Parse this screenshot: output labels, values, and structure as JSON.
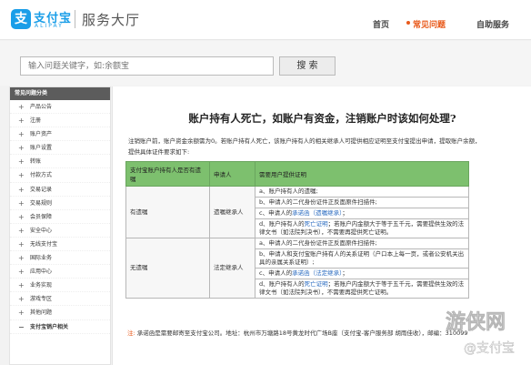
{
  "header": {
    "logo_mark": "支",
    "logo_cn": "支付宝",
    "logo_en": "ALIPAY",
    "hall": "服务大厅",
    "nav": {
      "home": "首页",
      "faq": "常见问题",
      "self_service": "自助服务"
    }
  },
  "search": {
    "placeholder": "输入问题关键字，如:余额宝",
    "button": "搜 索"
  },
  "sidebar": {
    "title": "常见问题分类",
    "items": [
      "产品公告",
      "注册",
      "账户资产",
      "账户设置",
      "转账",
      "付款方式",
      "交易记录",
      "交易规则",
      "会员保障",
      "安全中心",
      "无线支付宝",
      "国际业务",
      "应用中心",
      "业务实现",
      "游戏专区",
      "其他问题",
      "支付宝销户相关"
    ]
  },
  "question": {
    "title": "账户持有人死亡，如账户有资金，注销账户时该如何处理?",
    "intro": "注销账户前，账户资金余额需为0。若账户持有人死亡，该账户持有人的相关继承人可提供相应证明至支付宝提出申请，提取账户余额，提供具体证件要求如下:"
  },
  "table": {
    "headers": [
      "支付宝账户持有人是否有遗嘱",
      "申请人",
      "需要用户提供证明"
    ],
    "groups": [
      {
        "will": "有遗嘱",
        "applicant": "遗嘱继承人",
        "proofs": [
          {
            "pre": "a、账户持有人的遗嘱;",
            "hl": "",
            "post": ""
          },
          {
            "pre": "b、申请人的二代身份证件正反面原件扫描件;",
            "hl": "",
            "post": ""
          },
          {
            "pre": "c、申请人的",
            "hl": "承诺函（遗嘱继承）",
            "post": "；"
          },
          {
            "pre": "d、账户持有人的",
            "hl": "死亡证明",
            "post": "；若账户内金额大于等于五千元，需要提供生效的法律文书（如法院判决书），不需要再提供死亡证明。"
          }
        ]
      },
      {
        "will": "无遗嘱",
        "applicant": "法定继承人",
        "proofs": [
          {
            "pre": "a、申请人的二代身份证件正反面原件扫描件;",
            "hl": "",
            "post": ""
          },
          {
            "pre": "b、申请人和支付宝账户持有人的关系证明（户口本上每一页，或者公安机关出具的亲属关系证明）;",
            "hl": "",
            "post": ""
          },
          {
            "pre": "c、申请人的",
            "hl": "承诺函（法定继承）",
            "post": "；"
          },
          {
            "pre": "d、账户持有人的",
            "hl": "死亡证明",
            "post": "；若账户内金额大于等于五千元，需要提供生效的法律文书（如法院判决书），不需要再提供死亡证明。"
          }
        ]
      }
    ]
  },
  "note": {
    "label": "注:",
    "text": "承诺函是需要邮寄至支付宝公司。地址：杭州市万塘路18号黄龙时代广场B座（支付宝-客户服务部 胡雨佳收），邮编：310099"
  },
  "watermark": {
    "site": "游侠网",
    "brand": "@支付宝"
  },
  "colors": {
    "brand": "#1a9ee8",
    "accent": "#e8591a",
    "table_header": "#7dc06e",
    "link": "#2a6bc0"
  }
}
